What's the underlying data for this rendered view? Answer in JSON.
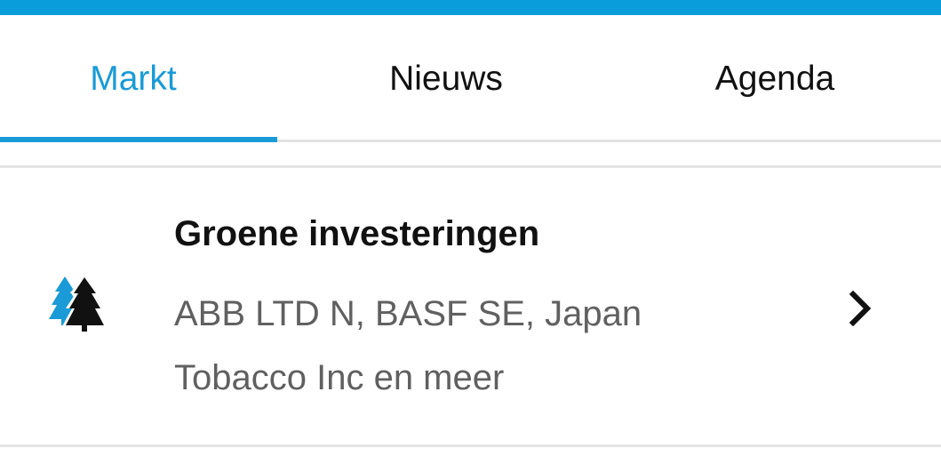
{
  "tabs": {
    "markt": "Markt",
    "nieuws": "Nieuws",
    "agenda": "Agenda",
    "active": "markt"
  },
  "theme": {
    "accent": "#1a9bd7",
    "top_bar": "#0a9ddb"
  },
  "list": {
    "items": [
      {
        "icon": "green-investments-trees-icon",
        "title": "Groene investeringen",
        "subtitle": "ABB LTD N, BASF SE, Japan Tobacco Inc en meer"
      }
    ]
  }
}
